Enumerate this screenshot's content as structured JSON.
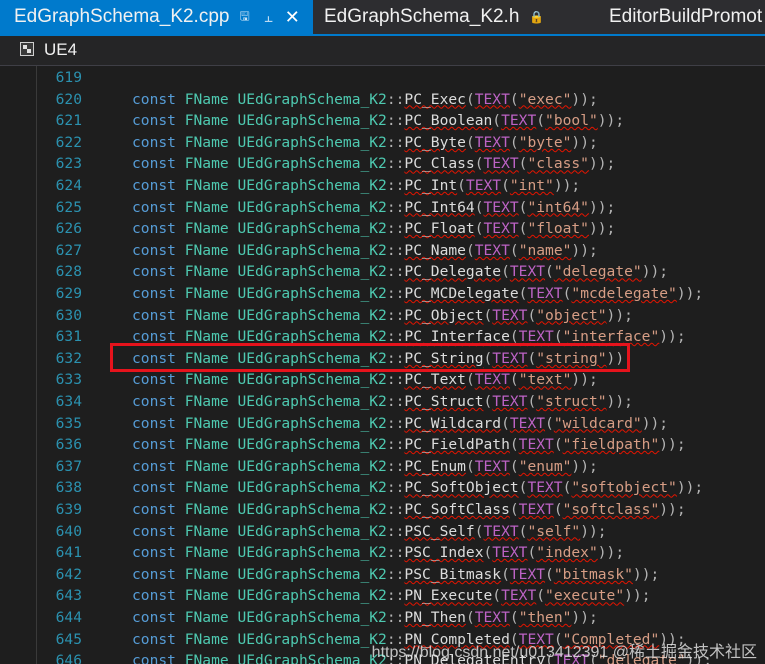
{
  "tabs": [
    {
      "label": "EdGraphSchema_K2.cpp",
      "active": true,
      "pin_icon": "pin-icon",
      "close_icon": "close-icon"
    },
    {
      "label": "EdGraphSchema_K2.h",
      "active": false,
      "pin_icon": "lock-icon"
    },
    {
      "label": "EditorBuildPromot",
      "active": false
    }
  ],
  "navbar": {
    "project": "UE4",
    "icon": "project-icon"
  },
  "code": {
    "prefix_keyword": "const",
    "prefix_type": "FName",
    "class_name": "UEdGraphSchema_K2",
    "macro": "TEXT",
    "lines": [
      {
        "number": "619",
        "member": "",
        "value": ""
      },
      {
        "number": "620",
        "member": "PC_Exec",
        "value": "\"exec\""
      },
      {
        "number": "621",
        "member": "PC_Boolean",
        "value": "\"bool\""
      },
      {
        "number": "622",
        "member": "PC_Byte",
        "value": "\"byte\""
      },
      {
        "number": "623",
        "member": "PC_Class",
        "value": "\"class\""
      },
      {
        "number": "624",
        "member": "PC_Int",
        "value": "\"int\""
      },
      {
        "number": "625",
        "member": "PC_Int64",
        "value": "\"int64\""
      },
      {
        "number": "626",
        "member": "PC_Float",
        "value": "\"float\""
      },
      {
        "number": "627",
        "member": "PC_Name",
        "value": "\"name\""
      },
      {
        "number": "628",
        "member": "PC_Delegate",
        "value": "\"delegate\""
      },
      {
        "number": "629",
        "member": "PC_MCDelegate",
        "value": "\"mcdelegate\""
      },
      {
        "number": "630",
        "member": "PC_Object",
        "value": "\"object\""
      },
      {
        "number": "631",
        "member": "PC_Interface",
        "value": "\"interface\""
      },
      {
        "number": "632",
        "member": "PC_String",
        "value": "\"string\""
      },
      {
        "number": "633",
        "member": "PC_Text",
        "value": "\"text\""
      },
      {
        "number": "634",
        "member": "PC_Struct",
        "value": "\"struct\""
      },
      {
        "number": "635",
        "member": "PC_Wildcard",
        "value": "\"wildcard\""
      },
      {
        "number": "636",
        "member": "PC_FieldPath",
        "value": "\"fieldpath\""
      },
      {
        "number": "637",
        "member": "PC_Enum",
        "value": "\"enum\""
      },
      {
        "number": "638",
        "member": "PC_SoftObject",
        "value": "\"softobject\""
      },
      {
        "number": "639",
        "member": "PC_SoftClass",
        "value": "\"softclass\""
      },
      {
        "number": "640",
        "member": "PSC_Self",
        "value": "\"self\""
      },
      {
        "number": "641",
        "member": "PSC_Index",
        "value": "\"index\""
      },
      {
        "number": "642",
        "member": "PSC_Bitmask",
        "value": "\"bitmask\""
      },
      {
        "number": "643",
        "member": "PN_Execute",
        "value": "\"execute\""
      },
      {
        "number": "644",
        "member": "PN_Then",
        "value": "\"then\""
      },
      {
        "number": "645",
        "member": "PN_Completed",
        "value": "\"Completed\""
      },
      {
        "number": "646",
        "member": "PN_DelegateEntry",
        "value": "\"delegate\""
      }
    ]
  },
  "highlight": {
    "line_number": "632",
    "color": "#e6131c"
  },
  "watermark": "https://blog.csdn.net/u013412391 @稀土掘金技术社区",
  "colors": {
    "tab_active": "#007acc",
    "keyword": "#569cd6",
    "type": "#4ec9b0",
    "macro": "#bd63c5",
    "string": "#d69d85",
    "line_number": "#2b91af"
  }
}
